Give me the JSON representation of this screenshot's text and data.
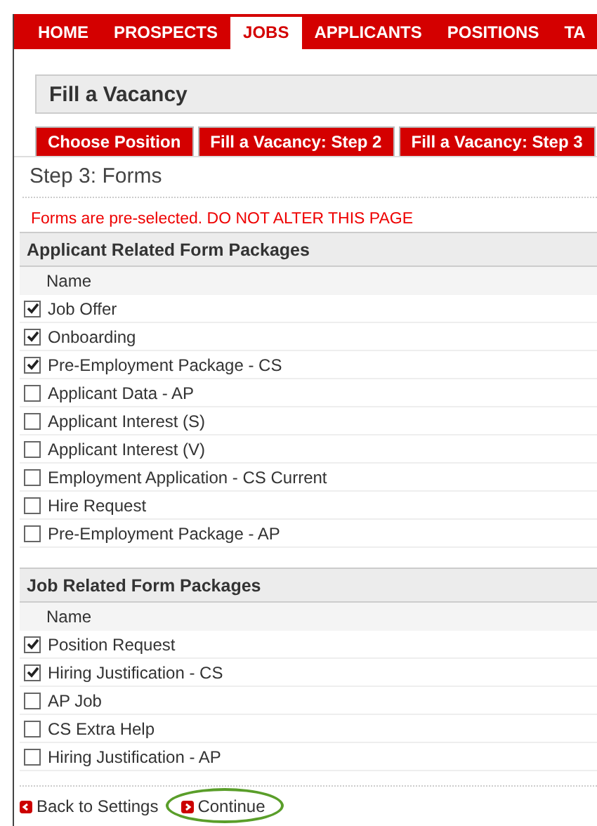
{
  "nav": [
    {
      "label": "HOME",
      "selected": false
    },
    {
      "label": "PROSPECTS",
      "selected": false
    },
    {
      "label": "JOBS",
      "selected": true
    },
    {
      "label": "APPLICANTS",
      "selected": false
    },
    {
      "label": "POSITIONS",
      "selected": false
    },
    {
      "label": "TA",
      "selected": false
    }
  ],
  "title": "Fill a Vacancy",
  "step_tabs": [
    "Choose Position",
    "Fill a Vacancy: Step 2",
    "Fill a Vacancy: Step 3"
  ],
  "step_heading": "Step 3: Forms",
  "warning": "Forms are pre-selected. DO NOT ALTER THIS PAGE",
  "sections": [
    {
      "title": "Applicant Related Form Packages",
      "column": "Name",
      "rows": [
        {
          "label": "Job Offer",
          "checked": true
        },
        {
          "label": "Onboarding",
          "checked": true
        },
        {
          "label": "Pre-Employment Package - CS",
          "checked": true
        },
        {
          "label": "Applicant Data - AP",
          "checked": false
        },
        {
          "label": "Applicant Interest (S)",
          "checked": false
        },
        {
          "label": "Applicant Interest (V)",
          "checked": false
        },
        {
          "label": "Employment Application - CS Current",
          "checked": false
        },
        {
          "label": "Hire Request",
          "checked": false
        },
        {
          "label": "Pre-Employment Package - AP",
          "checked": false
        }
      ]
    },
    {
      "title": "Job Related Form Packages",
      "column": "Name",
      "rows": [
        {
          "label": "Position Request",
          "checked": true
        },
        {
          "label": "Hiring Justification - CS",
          "checked": true
        },
        {
          "label": "AP Job",
          "checked": false
        },
        {
          "label": "CS Extra Help",
          "checked": false
        },
        {
          "label": "Hiring Justification - AP",
          "checked": false
        }
      ]
    }
  ],
  "footer": {
    "back": "Back to Settings",
    "continue": {
      "label": "Continue",
      "highlighted": true
    }
  }
}
